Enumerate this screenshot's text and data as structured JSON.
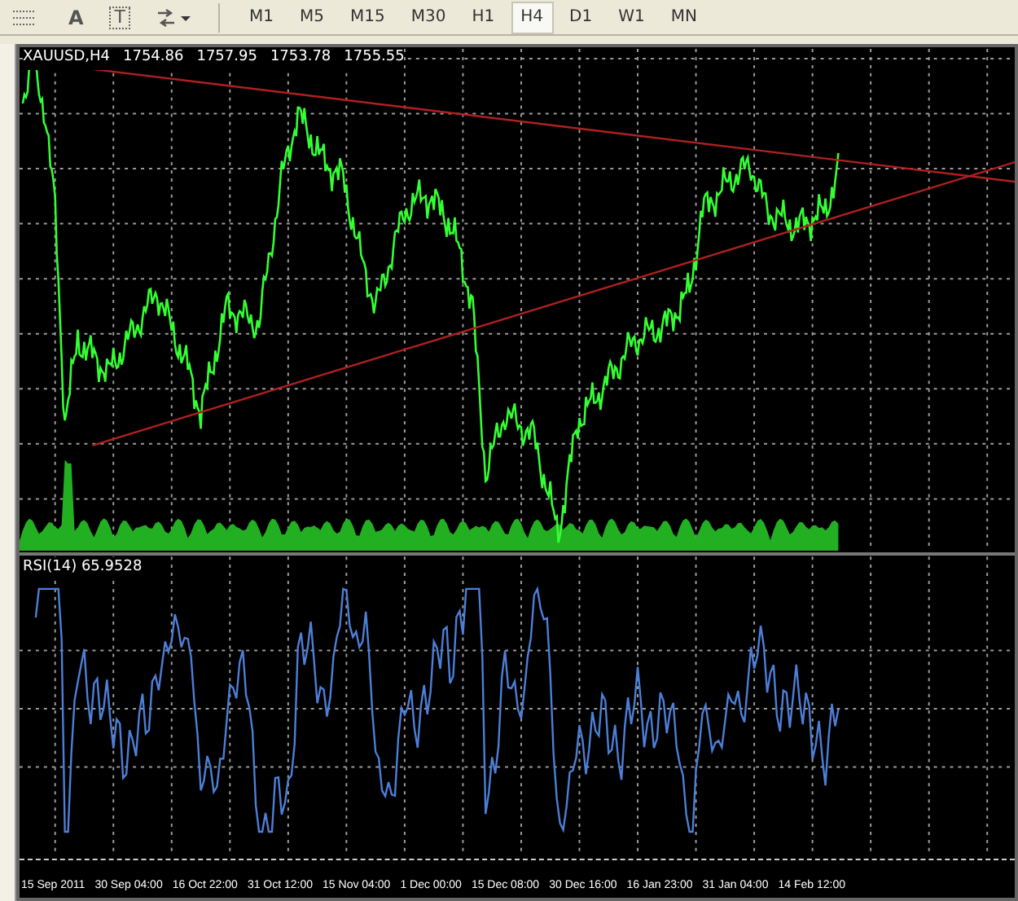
{
  "toolbar": {
    "tools": [
      {
        "kind": "text",
        "label": "A"
      },
      {
        "kind": "label",
        "label": "T"
      }
    ],
    "timeframes": [
      {
        "label": "M1",
        "selected": false
      },
      {
        "label": "M5",
        "selected": false
      },
      {
        "label": "M15",
        "selected": false
      },
      {
        "label": "M30",
        "selected": false
      },
      {
        "label": "H1",
        "selected": false
      },
      {
        "label": "H4",
        "selected": true
      },
      {
        "label": "D1",
        "selected": false
      },
      {
        "label": "W1",
        "selected": false
      },
      {
        "label": "MN",
        "selected": false
      }
    ]
  },
  "price_chart": {
    "symbol": "XAUUSD,H4",
    "quotes": [
      "1754.86",
      "1757.95",
      "1753.78",
      "1755.55"
    ]
  },
  "indicator": {
    "label": "RSI(14) 65.9528"
  },
  "time_axis": [
    "15 Sep 2011",
    "30 Sep 04:00",
    "16 Oct 22:00",
    "31 Oct 12:00",
    "15 Nov 04:00",
    "1 Dec 00:00",
    "15 Dec 08:00",
    "30 Dec 16:00",
    "16 Jan 23:00",
    "31 Jan 04:00",
    "14 Feb 12:00"
  ]
}
